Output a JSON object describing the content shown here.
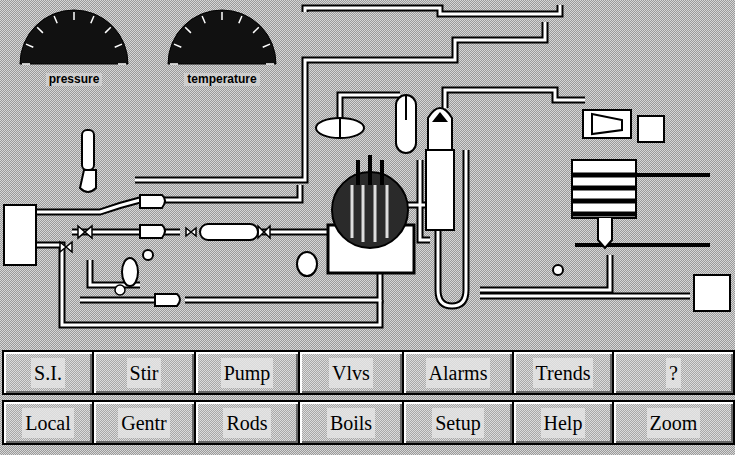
{
  "gauges": [
    {
      "label": "pressure"
    },
    {
      "label": "temperature"
    }
  ],
  "buttons": [
    [
      {
        "label": "S.I."
      },
      {
        "label": "Stir"
      },
      {
        "label": "Pump"
      },
      {
        "label": "Vlvs"
      },
      {
        "label": "Alarms"
      },
      {
        "label": "Trends"
      },
      {
        "label": "?"
      }
    ],
    [
      {
        "label": "Local"
      },
      {
        "label": "Gentr"
      },
      {
        "label": "Rods"
      },
      {
        "label": "Boils"
      },
      {
        "label": "Setup"
      },
      {
        "label": "Help"
      },
      {
        "label": "Zoom"
      }
    ]
  ]
}
